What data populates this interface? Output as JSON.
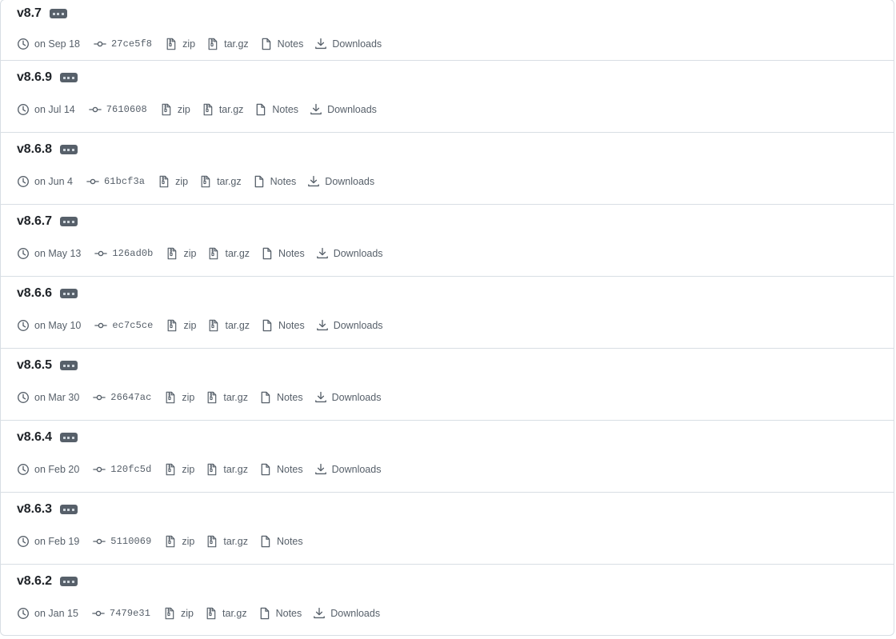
{
  "page": {
    "kind": "github-releases-list",
    "colors": {
      "border": "#d8dee4",
      "text_primary": "#1f2328",
      "text_muted": "#57606a",
      "badge_bg": "#57606a",
      "badge_dot": "#d0d7de",
      "background": "#ffffff"
    }
  },
  "labels": {
    "zip": "zip",
    "targz": "tar.gz",
    "notes": "Notes",
    "downloads": "Downloads",
    "kebab": "..."
  },
  "icons": {
    "kebab": "kebab-horizontal-icon",
    "clock": "clock-icon",
    "commit": "git-commit-icon",
    "file_zip": "file-zip-icon",
    "file": "file-icon",
    "download": "download-icon"
  },
  "releases": [
    {
      "tag": "v8.7",
      "date": "on Sep 18",
      "commit": "27ce5f8",
      "zip": "zip",
      "targz": "tar.gz",
      "notes": "Notes",
      "downloads": "Downloads",
      "has_downloads": true
    },
    {
      "tag": "v8.6.9",
      "date": "on Jul 14",
      "commit": "7610608",
      "zip": "zip",
      "targz": "tar.gz",
      "notes": "Notes",
      "downloads": "Downloads",
      "has_downloads": true
    },
    {
      "tag": "v8.6.8",
      "date": "on Jun 4",
      "commit": "61bcf3a",
      "zip": "zip",
      "targz": "tar.gz",
      "notes": "Notes",
      "downloads": "Downloads",
      "has_downloads": true
    },
    {
      "tag": "v8.6.7",
      "date": "on May 13",
      "commit": "126ad0b",
      "zip": "zip",
      "targz": "tar.gz",
      "notes": "Notes",
      "downloads": "Downloads",
      "has_downloads": true
    },
    {
      "tag": "v8.6.6",
      "date": "on May 10",
      "commit": "ec7c5ce",
      "zip": "zip",
      "targz": "tar.gz",
      "notes": "Notes",
      "downloads": "Downloads",
      "has_downloads": true
    },
    {
      "tag": "v8.6.5",
      "date": "on Mar 30",
      "commit": "26647ac",
      "zip": "zip",
      "targz": "tar.gz",
      "notes": "Notes",
      "downloads": "Downloads",
      "has_downloads": true
    },
    {
      "tag": "v8.6.4",
      "date": "on Feb 20",
      "commit": "120fc5d",
      "zip": "zip",
      "targz": "tar.gz",
      "notes": "Notes",
      "downloads": "Downloads",
      "has_downloads": true
    },
    {
      "tag": "v8.6.3",
      "date": "on Feb 19",
      "commit": "5110069",
      "zip": "zip",
      "targz": "tar.gz",
      "notes": "Notes",
      "downloads": "",
      "has_downloads": false
    },
    {
      "tag": "v8.6.2",
      "date": "on Jan 15",
      "commit": "7479e31",
      "zip": "zip",
      "targz": "tar.gz",
      "notes": "Notes",
      "downloads": "Downloads",
      "has_downloads": true
    }
  ]
}
